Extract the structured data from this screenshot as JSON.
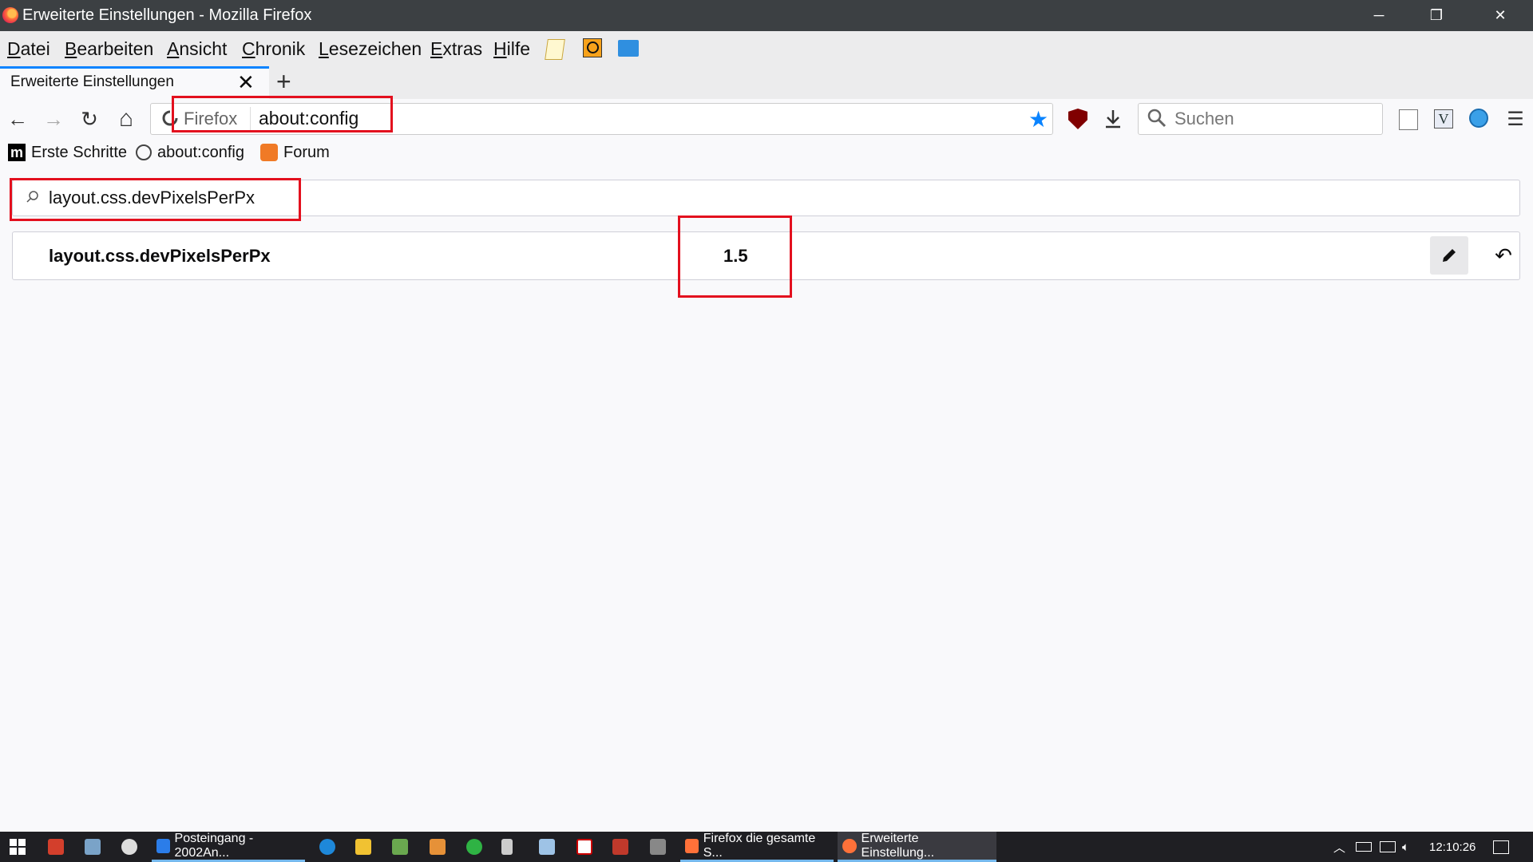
{
  "window": {
    "title": "Erweiterte Einstellungen - Mozilla Firefox",
    "controls": {
      "minimize": "─",
      "restore": "❐",
      "close": "✕"
    }
  },
  "menubar": {
    "items": [
      {
        "label": "Datei",
        "accel": "D",
        "rest": "atei"
      },
      {
        "label": "Bearbeiten",
        "accel": "B",
        "rest": "earbeiten"
      },
      {
        "label": "Ansicht",
        "accel": "A",
        "rest": "nsicht"
      },
      {
        "label": "Chronik",
        "accel": "C",
        "rest": "hronik"
      },
      {
        "label": "Lesezeichen",
        "accel": "L",
        "rest": "esezeichen"
      },
      {
        "label": "Extras",
        "accel": "E",
        "rest": "xtras"
      },
      {
        "label": "Hilfe",
        "accel": "H",
        "rest": "ilfe"
      }
    ],
    "extra_icons": [
      "notepad-icon",
      "magnifier-icon",
      "folder-icon"
    ]
  },
  "tabs": [
    {
      "label": "Erweiterte Einstellungen",
      "close": "✕",
      "active": true
    }
  ],
  "newtab": "+",
  "navbar": {
    "back": "←",
    "forward": "→",
    "reload": "↻",
    "home": "⌂",
    "identity_label": "Firefox",
    "url": "about:config",
    "bookmark_star": "★",
    "search_placeholder": "Suchen"
  },
  "bookmarks": [
    {
      "label": "Erste Schritte",
      "icon": "mozilla-m-icon"
    },
    {
      "label": "about:config",
      "icon": "globe-icon"
    },
    {
      "label": "Forum",
      "icon": "firefox-forum-icon"
    }
  ],
  "config": {
    "search_value": "layout.css.devPixelsPerPx",
    "prefs": [
      {
        "name": "layout.css.devPixelsPerPx",
        "value": "1.5"
      }
    ],
    "reset_glyph": "↶"
  },
  "taskbar": {
    "windows": [
      {
        "label": "Posteingang - 2002An...",
        "active": false,
        "color": "#2b7de9"
      },
      {
        "label": "Firefox die gesamte S...",
        "active": false,
        "color": "#ff7139"
      },
      {
        "label": "Erweiterte Einstellung...",
        "active": true,
        "color": "#ff7139"
      }
    ],
    "clock": "12:10:26"
  },
  "colors": {
    "accent": "#0a84ff",
    "highlight_box": "#e3101e",
    "titlebar": "#3c4043"
  }
}
